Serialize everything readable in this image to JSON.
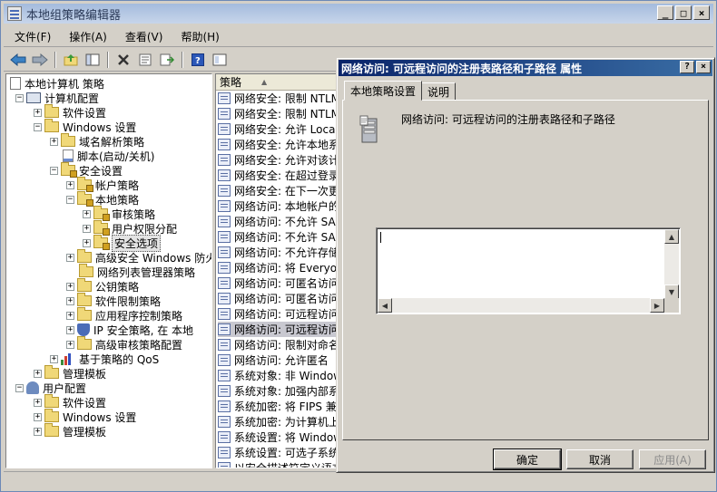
{
  "window": {
    "title": "本地组策略编辑器"
  },
  "menu": [
    "文件(F)",
    "操作(A)",
    "查看(V)",
    "帮助(H)"
  ],
  "tree": [
    {
      "label": "本地计算机 策略",
      "icon": "document-icon",
      "expander": ""
    },
    {
      "label": "计算机配置",
      "icon": "computer-icon",
      "expander": "−"
    },
    {
      "label": "软件设置",
      "icon": "folder-icon",
      "expander": "+"
    },
    {
      "label": "Windows 设置",
      "icon": "folder-icon",
      "expander": "−"
    },
    {
      "label": "域名解析策略",
      "icon": "folder-icon",
      "expander": "+"
    },
    {
      "label": "脚本(启动/关机)",
      "icon": "script-icon",
      "expander": ""
    },
    {
      "label": "安全设置",
      "icon": "secure-folder-icon",
      "expander": "−"
    },
    {
      "label": "帐户策略",
      "icon": "secure-folder-icon",
      "expander": "+"
    },
    {
      "label": "本地策略",
      "icon": "secure-folder-icon",
      "expander": "−"
    },
    {
      "label": "审核策略",
      "icon": "secure-folder-icon",
      "expander": "+"
    },
    {
      "label": "用户权限分配",
      "icon": "secure-folder-icon",
      "expander": "+"
    },
    {
      "label": "安全选项",
      "icon": "secure-folder-icon",
      "expander": "+"
    },
    {
      "label": "高级安全 Windows 防火",
      "icon": "folder-icon",
      "expander": "+"
    },
    {
      "label": "网络列表管理器策略",
      "icon": "folder-icon",
      "expander": ""
    },
    {
      "label": "公钥策略",
      "icon": "folder-icon",
      "expander": "+"
    },
    {
      "label": "软件限制策略",
      "icon": "folder-icon",
      "expander": "+"
    },
    {
      "label": "应用程序控制策略",
      "icon": "folder-icon",
      "expander": "+"
    },
    {
      "label": "IP 安全策略, 在 本地",
      "icon": "shield-icon",
      "expander": "+"
    },
    {
      "label": "高级审核策略配置",
      "icon": "folder-icon",
      "expander": "+"
    },
    {
      "label": "基于策略的 QoS",
      "icon": "chart-icon",
      "expander": "+"
    },
    {
      "label": "管理模板",
      "icon": "folder-icon",
      "expander": "+"
    },
    {
      "label": "用户配置",
      "icon": "user-icon",
      "expander": "−"
    },
    {
      "label": "软件设置",
      "icon": "folder-icon",
      "expander": "+"
    },
    {
      "label": "Windows 设置",
      "icon": "folder-icon",
      "expander": "+"
    },
    {
      "label": "管理模板",
      "icon": "folder-icon",
      "expander": "+"
    }
  ],
  "list": {
    "column_header": "策略",
    "rows": [
      "网络安全: 限制 NTLM",
      "网络安全: 限制 NTLM",
      "网络安全: 允许 Loca",
      "网络安全: 允许本地系",
      "网络安全: 允许对该计",
      "网络安全: 在超过登录",
      "网络安全: 在下一次更",
      "网络访问: 本地帐户的",
      "网络访问: 不允许 SA",
      "网络访问: 不允许 SA",
      "网络访问: 不允许存储",
      "网络访问: 将 Everyo",
      "网络访问: 可匿名访问",
      "网络访问: 可匿名访问",
      "网络访问: 可远程访问",
      "网络访问: 可远程访问",
      "网络访问: 限制对命名",
      "网络访问: 允许匿名",
      "系统对象: 非 Window",
      "系统对象: 加强内部系",
      "系统加密: 将 FIPS 兼",
      "系统加密: 为计算机上",
      "系统设置: 将 Window",
      "系统设置: 可选子系统",
      "以安全描述符定义语言"
    ]
  },
  "dialog": {
    "title": "网络访问: 可远程访问的注册表路径和子路径 属性",
    "tabs": [
      "本地策略设置",
      "说明"
    ],
    "policy_name": "网络访问: 可远程访问的注册表路径和子路径",
    "value": "",
    "buttons": {
      "ok": "确定",
      "cancel": "取消",
      "apply": "应用(A)"
    }
  }
}
